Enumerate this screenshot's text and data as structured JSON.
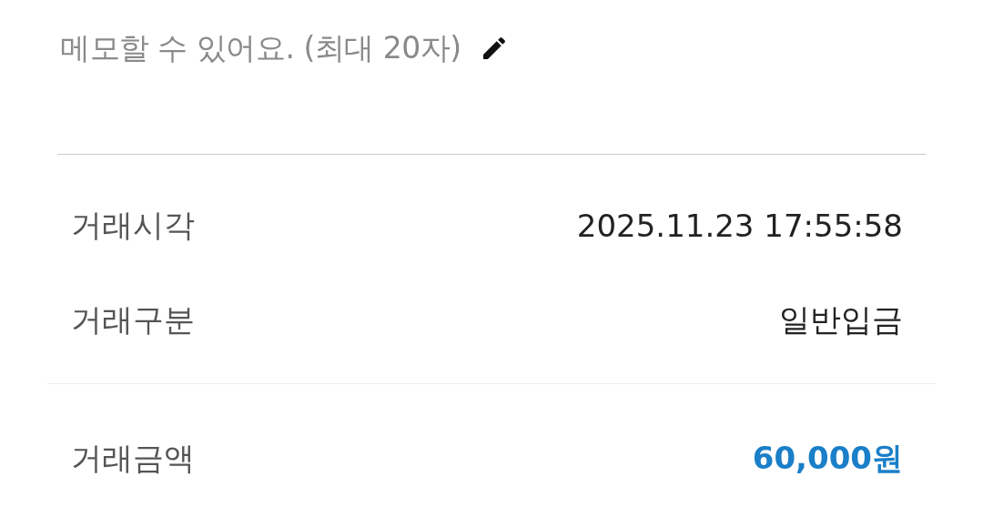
{
  "memo": {
    "placeholder": "메모할 수 있어요. (최대 20자)"
  },
  "details": [
    {
      "label": "거래시각",
      "value": "2025.11.23 17:55:58"
    },
    {
      "label": "거래구분",
      "value": "일반입금"
    }
  ],
  "amount": {
    "label": "거래금액",
    "value": "60,000원",
    "kind": "amount"
  }
}
